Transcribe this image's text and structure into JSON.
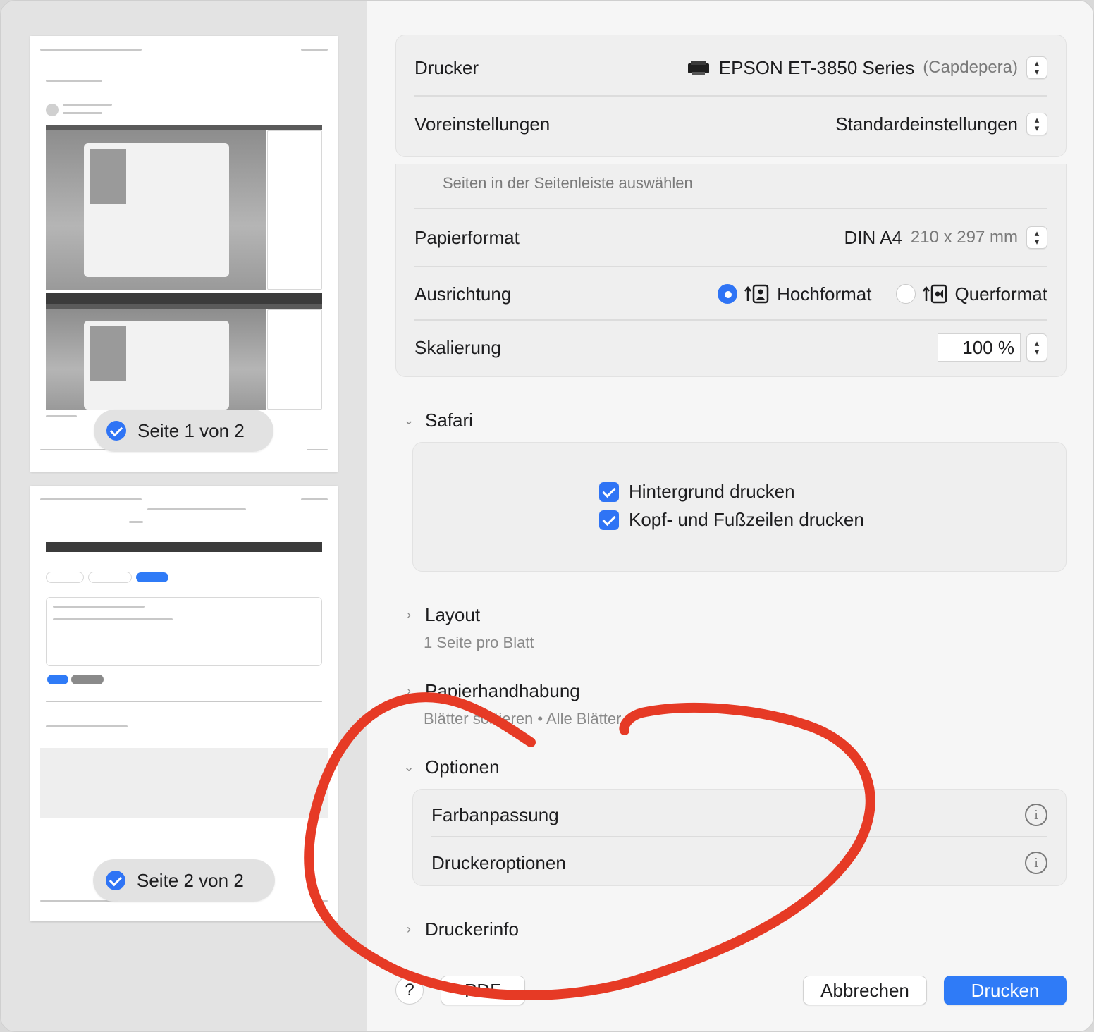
{
  "preview": {
    "pages": [
      {
        "badge": "Seite 1 von 2"
      },
      {
        "badge": "Seite 2 von 2"
      }
    ]
  },
  "printer": {
    "label": "Drucker",
    "name": "EPSON ET-3850 Series",
    "location": "(Capdepera)"
  },
  "presets": {
    "label": "Voreinstellungen",
    "value": "Standardeinstellungen"
  },
  "pages_hint": "Seiten in der Seitenleiste auswählen",
  "paper": {
    "label": "Papierformat",
    "value": "DIN A4",
    "size": "210 x 297 mm"
  },
  "orientation": {
    "label": "Ausrichtung",
    "portrait": "Hochformat",
    "landscape": "Querformat",
    "selected": "Hochformat"
  },
  "scaling": {
    "label": "Skalierung",
    "value": "100 %"
  },
  "safari": {
    "title": "Safari",
    "background_print": "Hintergrund drucken",
    "headers_footers": "Kopf- und Fußzeilen drucken"
  },
  "layout": {
    "title": "Layout",
    "summary": "1 Seite pro Blatt"
  },
  "paper_handling": {
    "title": "Papierhandhabung",
    "summary": "Blätter sortieren • Alle Blätter"
  },
  "options": {
    "title": "Optionen",
    "color_matching": "Farbanpassung",
    "printer_options": "Druckeroptionen"
  },
  "printer_info": {
    "title": "Druckerinfo"
  },
  "footer": {
    "help": "?",
    "pdf": "PDF",
    "cancel": "Abbrechen",
    "print": "Drucken"
  },
  "colors": {
    "accent": "#2f7bf7",
    "annotation": "#e63a25"
  }
}
